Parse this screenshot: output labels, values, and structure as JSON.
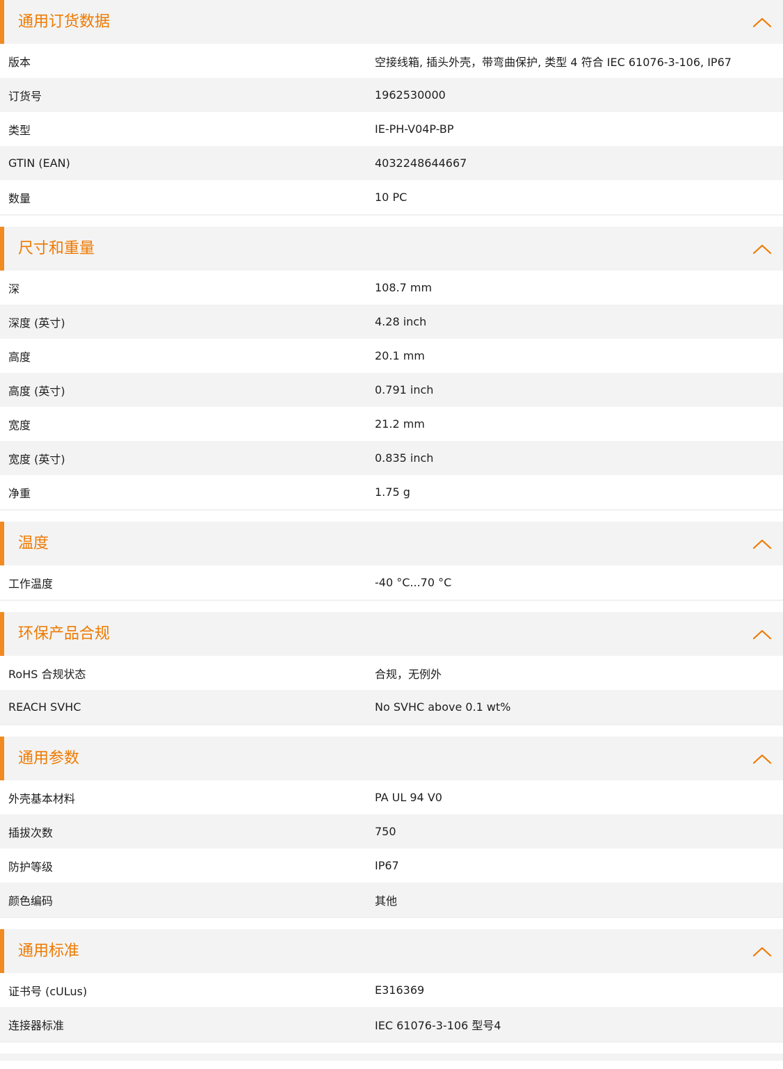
{
  "accent_color": "#ee7a00",
  "icons": {
    "collapse": "chevron-up-icon"
  },
  "sections": [
    {
      "title": "通用订货数据",
      "rows": [
        {
          "label": "版本",
          "value": "空接线箱, 插头外壳，带弯曲保护, 类型 4 符合 IEC 61076-3-106, IP67"
        },
        {
          "label": "订货号",
          "value": "1962530000"
        },
        {
          "label": "类型",
          "value": "IE-PH-V04P-BP"
        },
        {
          "label": "GTIN (EAN)",
          "value": "4032248644667"
        },
        {
          "label": "数量",
          "value": "10  PC"
        }
      ]
    },
    {
      "title": "尺寸和重量",
      "rows": [
        {
          "label": "深",
          "value": "108.7  mm"
        },
        {
          "label": "深度 (英寸)",
          "value": "4.28  inch"
        },
        {
          "label": "高度",
          "value": "20.1  mm"
        },
        {
          "label": "高度 (英寸)",
          "value": "0.791  inch"
        },
        {
          "label": "宽度",
          "value": "21.2  mm"
        },
        {
          "label": "宽度 (英寸)",
          "value": "0.835  inch"
        },
        {
          "label": "净重",
          "value": "1.75  g"
        }
      ]
    },
    {
      "title": "温度",
      "rows": [
        {
          "label": "工作温度",
          "value": "-40 °C...70 °C"
        }
      ]
    },
    {
      "title": "环保产品合规",
      "rows": [
        {
          "label": "RoHS 合规状态",
          "value": "合规，无例外"
        },
        {
          "label": "REACH SVHC",
          "value": "No SVHC above 0.1 wt%"
        }
      ]
    },
    {
      "title": "通用参数",
      "rows": [
        {
          "label": "外壳基本材料",
          "value": "PA UL 94 V0"
        },
        {
          "label": "插拔次数",
          "value": "750"
        },
        {
          "label": "防护等级",
          "value": "IP67"
        },
        {
          "label": "颜色编码",
          "value": "其他"
        }
      ]
    },
    {
      "title": "通用标准",
      "rows": [
        {
          "label": "证书号 (cULus)",
          "value": "E316369"
        },
        {
          "label": "连接器标准",
          "value": "IEC 61076-3-106 型号4"
        }
      ]
    }
  ]
}
